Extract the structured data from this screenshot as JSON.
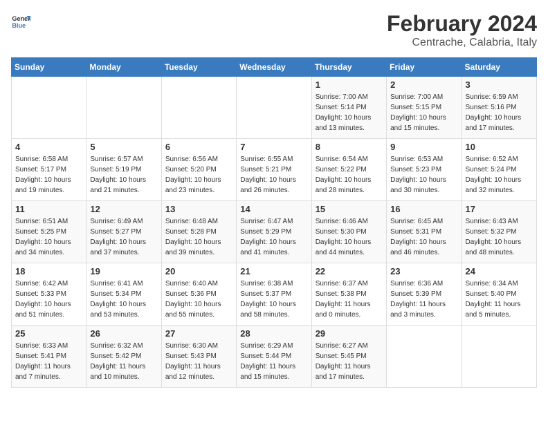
{
  "header": {
    "logo_line1": "General",
    "logo_line2": "Blue",
    "month_year": "February 2024",
    "location": "Centrache, Calabria, Italy"
  },
  "weekdays": [
    "Sunday",
    "Monday",
    "Tuesday",
    "Wednesday",
    "Thursday",
    "Friday",
    "Saturday"
  ],
  "weeks": [
    [
      {
        "day": "",
        "info": ""
      },
      {
        "day": "",
        "info": ""
      },
      {
        "day": "",
        "info": ""
      },
      {
        "day": "",
        "info": ""
      },
      {
        "day": "1",
        "info": "Sunrise: 7:00 AM\nSunset: 5:14 PM\nDaylight: 10 hours\nand 13 minutes."
      },
      {
        "day": "2",
        "info": "Sunrise: 7:00 AM\nSunset: 5:15 PM\nDaylight: 10 hours\nand 15 minutes."
      },
      {
        "day": "3",
        "info": "Sunrise: 6:59 AM\nSunset: 5:16 PM\nDaylight: 10 hours\nand 17 minutes."
      }
    ],
    [
      {
        "day": "4",
        "info": "Sunrise: 6:58 AM\nSunset: 5:17 PM\nDaylight: 10 hours\nand 19 minutes."
      },
      {
        "day": "5",
        "info": "Sunrise: 6:57 AM\nSunset: 5:19 PM\nDaylight: 10 hours\nand 21 minutes."
      },
      {
        "day": "6",
        "info": "Sunrise: 6:56 AM\nSunset: 5:20 PM\nDaylight: 10 hours\nand 23 minutes."
      },
      {
        "day": "7",
        "info": "Sunrise: 6:55 AM\nSunset: 5:21 PM\nDaylight: 10 hours\nand 26 minutes."
      },
      {
        "day": "8",
        "info": "Sunrise: 6:54 AM\nSunset: 5:22 PM\nDaylight: 10 hours\nand 28 minutes."
      },
      {
        "day": "9",
        "info": "Sunrise: 6:53 AM\nSunset: 5:23 PM\nDaylight: 10 hours\nand 30 minutes."
      },
      {
        "day": "10",
        "info": "Sunrise: 6:52 AM\nSunset: 5:24 PM\nDaylight: 10 hours\nand 32 minutes."
      }
    ],
    [
      {
        "day": "11",
        "info": "Sunrise: 6:51 AM\nSunset: 5:25 PM\nDaylight: 10 hours\nand 34 minutes."
      },
      {
        "day": "12",
        "info": "Sunrise: 6:49 AM\nSunset: 5:27 PM\nDaylight: 10 hours\nand 37 minutes."
      },
      {
        "day": "13",
        "info": "Sunrise: 6:48 AM\nSunset: 5:28 PM\nDaylight: 10 hours\nand 39 minutes."
      },
      {
        "day": "14",
        "info": "Sunrise: 6:47 AM\nSunset: 5:29 PM\nDaylight: 10 hours\nand 41 minutes."
      },
      {
        "day": "15",
        "info": "Sunrise: 6:46 AM\nSunset: 5:30 PM\nDaylight: 10 hours\nand 44 minutes."
      },
      {
        "day": "16",
        "info": "Sunrise: 6:45 AM\nSunset: 5:31 PM\nDaylight: 10 hours\nand 46 minutes."
      },
      {
        "day": "17",
        "info": "Sunrise: 6:43 AM\nSunset: 5:32 PM\nDaylight: 10 hours\nand 48 minutes."
      }
    ],
    [
      {
        "day": "18",
        "info": "Sunrise: 6:42 AM\nSunset: 5:33 PM\nDaylight: 10 hours\nand 51 minutes."
      },
      {
        "day": "19",
        "info": "Sunrise: 6:41 AM\nSunset: 5:34 PM\nDaylight: 10 hours\nand 53 minutes."
      },
      {
        "day": "20",
        "info": "Sunrise: 6:40 AM\nSunset: 5:36 PM\nDaylight: 10 hours\nand 55 minutes."
      },
      {
        "day": "21",
        "info": "Sunrise: 6:38 AM\nSunset: 5:37 PM\nDaylight: 10 hours\nand 58 minutes."
      },
      {
        "day": "22",
        "info": "Sunrise: 6:37 AM\nSunset: 5:38 PM\nDaylight: 11 hours\nand 0 minutes."
      },
      {
        "day": "23",
        "info": "Sunrise: 6:36 AM\nSunset: 5:39 PM\nDaylight: 11 hours\nand 3 minutes."
      },
      {
        "day": "24",
        "info": "Sunrise: 6:34 AM\nSunset: 5:40 PM\nDaylight: 11 hours\nand 5 minutes."
      }
    ],
    [
      {
        "day": "25",
        "info": "Sunrise: 6:33 AM\nSunset: 5:41 PM\nDaylight: 11 hours\nand 7 minutes."
      },
      {
        "day": "26",
        "info": "Sunrise: 6:32 AM\nSunset: 5:42 PM\nDaylight: 11 hours\nand 10 minutes."
      },
      {
        "day": "27",
        "info": "Sunrise: 6:30 AM\nSunset: 5:43 PM\nDaylight: 11 hours\nand 12 minutes."
      },
      {
        "day": "28",
        "info": "Sunrise: 6:29 AM\nSunset: 5:44 PM\nDaylight: 11 hours\nand 15 minutes."
      },
      {
        "day": "29",
        "info": "Sunrise: 6:27 AM\nSunset: 5:45 PM\nDaylight: 11 hours\nand 17 minutes."
      },
      {
        "day": "",
        "info": ""
      },
      {
        "day": "",
        "info": ""
      }
    ]
  ]
}
